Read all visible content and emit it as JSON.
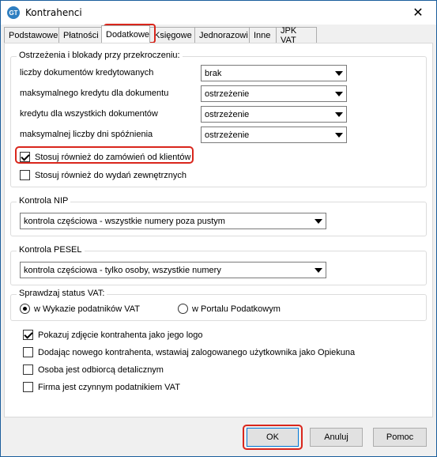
{
  "window": {
    "title": "Kontrahenci",
    "icon_text": "GT"
  },
  "tabs": [
    {
      "label": "Podstawowe"
    },
    {
      "label": "Płatności"
    },
    {
      "label": "Dodatkowe"
    },
    {
      "label": "Księgowe"
    },
    {
      "label": "Jednorazowi"
    },
    {
      "label": "Inne"
    },
    {
      "label": "JPK VAT"
    }
  ],
  "warnings": {
    "legend": "Ostrzeżenia i blokady przy przekroczeniu:",
    "rows": [
      {
        "label": "liczby dokumentów kredytowanych",
        "value": "brak"
      },
      {
        "label": "maksymalnego kredytu dla  dokumentu",
        "value": "ostrzeżenie"
      },
      {
        "label": "kredytu dla wszystkich dokumentów",
        "value": "ostrzeżenie"
      },
      {
        "label": "maksymalnej liczby dni spóźnienia",
        "value": "ostrzeżenie"
      }
    ],
    "apply_orders_label": "Stosuj również do zamówień od klientów",
    "apply_orders_checked": true,
    "apply_external_label": "Stosuj również do wydań zewnętrznych",
    "apply_external_checked": false
  },
  "nip": {
    "legend": "Kontrola NIP",
    "value": "kontrola częściowa - wszystkie numery poza pustym"
  },
  "pesel": {
    "legend": "Kontrola PESEL",
    "value": "kontrola częściowa - tylko osoby, wszystkie numery"
  },
  "vat_status": {
    "legend": "Sprawdzaj status VAT:",
    "option1": "w Wykazie podatników VAT",
    "option2": "w Portalu Podatkowym",
    "selected": "option1"
  },
  "options": [
    {
      "label": "Pokazuj zdjęcie kontrahenta jako jego logo",
      "checked": true
    },
    {
      "label": "Dodając nowego kontrahenta, wstawiaj zalogowanego użytkownika jako Opiekuna",
      "checked": false
    },
    {
      "label": "Osoba jest odbiorcą detalicznym",
      "checked": false
    },
    {
      "label": "Firma jest czynnym podatnikiem VAT",
      "checked": false
    }
  ],
  "buttons": {
    "ok": "OK",
    "cancel": "Anuluj",
    "help": "Pomoc"
  },
  "colors": {
    "highlight": "#d9261c",
    "title_border": "#1b5e9c"
  }
}
